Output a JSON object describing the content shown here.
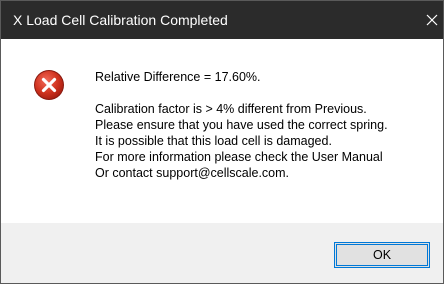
{
  "window": {
    "title": "X Load Cell Calibration Completed",
    "close_label": "Close"
  },
  "icon": {
    "name": "error-icon",
    "color": "#c42b1c"
  },
  "message": {
    "summary": "Relative Difference = 17.60%.",
    "lines": [
      "Calibration factor is > 4% different from Previous.",
      "Please ensure that you have used the correct spring.",
      "It is possible that this load cell is damaged.",
      "For more information please check the User Manual",
      "Or contact support@cellscale.com."
    ]
  },
  "buttons": {
    "ok_label": "OK"
  },
  "colors": {
    "titlebar": "#2b2b2b",
    "footer": "#f0f0f0",
    "button_border": "#0078d7"
  }
}
